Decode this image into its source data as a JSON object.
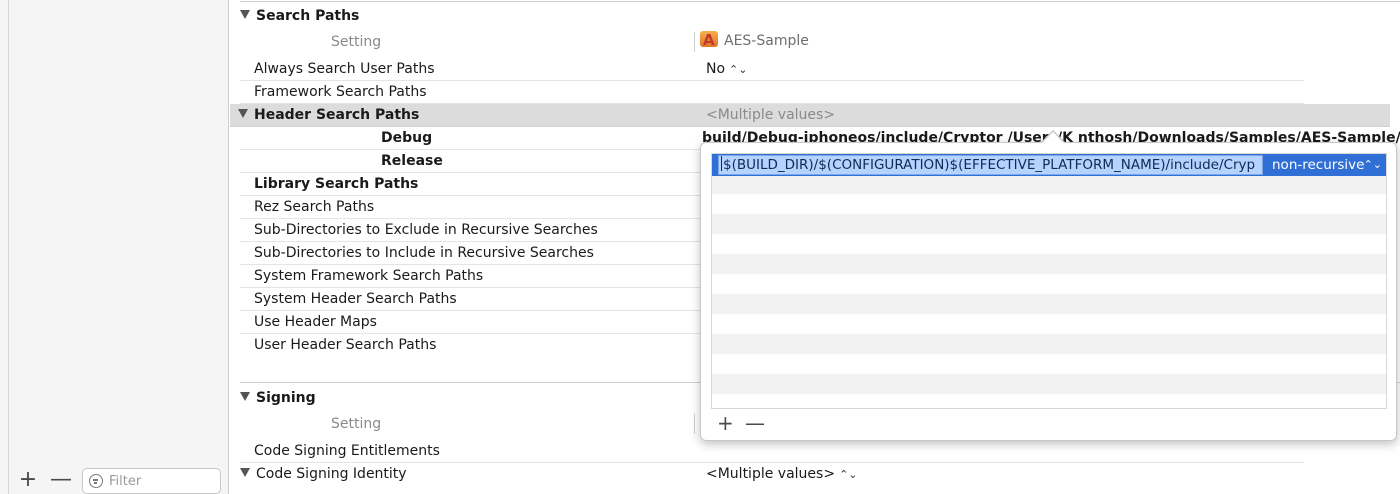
{
  "sidebar": {
    "add_label": "+",
    "remove_label": "—",
    "filter_placeholder": "Filter"
  },
  "search_paths": {
    "title": "Search Paths",
    "setting_header": "Setting",
    "target_name": "AES-Sample",
    "rows": [
      {
        "label": "Always Search User Paths",
        "value": "No"
      },
      {
        "label": "Framework Search Paths",
        "value": ""
      },
      {
        "label": "Header Search Paths",
        "value": "<Multiple values>"
      },
      {
        "label": "Debug",
        "value": "build/Debug-iphoneos/include/Cryptor /Users/K     nthosh/Downloads/Samples/AES-Sample/AE..."
      },
      {
        "label": "Release",
        "value": ""
      },
      {
        "label": "Library Search Paths",
        "value": ""
      },
      {
        "label": "Rez Search Paths",
        "value": ""
      },
      {
        "label": "Sub-Directories to Exclude in Recursive Searches",
        "value": ""
      },
      {
        "label": "Sub-Directories to Include in Recursive Searches",
        "value": ""
      },
      {
        "label": "System Framework Search Paths",
        "value": ""
      },
      {
        "label": "System Header Search Paths",
        "value": ""
      },
      {
        "label": "Use Header Maps",
        "value": ""
      },
      {
        "label": "User Header Search Paths",
        "value": ""
      }
    ]
  },
  "signing": {
    "title": "Signing",
    "setting_header": "Setting",
    "rows": [
      {
        "label": "Code Signing Entitlements",
        "value": ""
      },
      {
        "label": "Code Signing Identity",
        "value": "<Multiple values>"
      }
    ]
  },
  "popover": {
    "path_value": "$(BUILD_DIR)/$(CONFIGURATION)$(EFFECTIVE_PLATFORM_NAME)/include/Cryp",
    "recursion": "non-recursive",
    "add_label": "+",
    "remove_label": "—"
  },
  "icons": {
    "disclosure": "disclosure-triangle-icon",
    "target": "app-target-icon",
    "filter": "filter-icon",
    "stepper": "stepper-chevrons-icon"
  }
}
